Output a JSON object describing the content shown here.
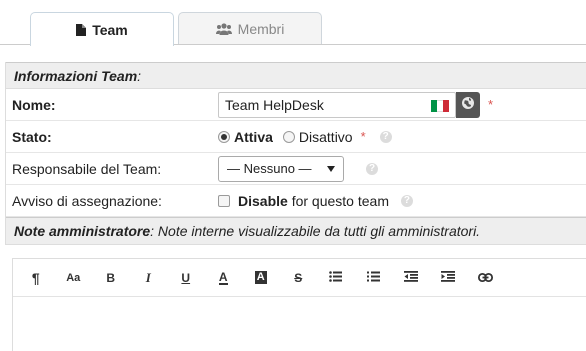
{
  "tabs": [
    {
      "label": "Team",
      "icon": "file-icon",
      "active": true
    },
    {
      "label": "Membri",
      "icon": "users-icon",
      "active": false
    }
  ],
  "section_info": {
    "title": "Informazioni Team",
    "suffix": ":"
  },
  "fields": {
    "name": {
      "label": "Nome:",
      "value": "Team HelpDesk",
      "required_mark": "*"
    },
    "status": {
      "label": "Stato:",
      "option_active": "Attiva",
      "option_inactive": "Disattivo",
      "selected": "Attiva",
      "required_mark": "*"
    },
    "lead": {
      "label": "Responsabile del Team:",
      "value": "— Nessuno —"
    },
    "alert": {
      "label": "Avviso di assegnazione:",
      "checkbox_strong": "Disable",
      "checkbox_rest": " for questo team",
      "checked": false
    }
  },
  "section_notes": {
    "title": "Note amministratore",
    "subtitle": ": Note interne visualizzabile da tutti gli amministratori."
  },
  "editor_toolbar": [
    {
      "name": "paragraph-format-icon",
      "glyph": "¶"
    },
    {
      "name": "font-size-icon",
      "glyph": "Aa"
    },
    {
      "name": "bold-icon",
      "glyph": "B"
    },
    {
      "name": "italic-icon",
      "glyph": "I"
    },
    {
      "name": "underline-icon",
      "glyph": "U"
    },
    {
      "name": "text-color-icon",
      "glyph": "A"
    },
    {
      "name": "background-color-icon",
      "glyph": "A"
    },
    {
      "name": "strikethrough-icon",
      "glyph": "S"
    },
    {
      "name": "unordered-list-icon",
      "glyph": ""
    },
    {
      "name": "ordered-list-icon",
      "glyph": ""
    },
    {
      "name": "outdent-icon",
      "glyph": ""
    },
    {
      "name": "indent-icon",
      "glyph": ""
    },
    {
      "name": "link-icon",
      "glyph": ""
    }
  ],
  "colors": {
    "required": "#d9534f",
    "flag_green": "#009246",
    "flag_white": "#ffffff",
    "flag_red": "#ce2b37"
  }
}
